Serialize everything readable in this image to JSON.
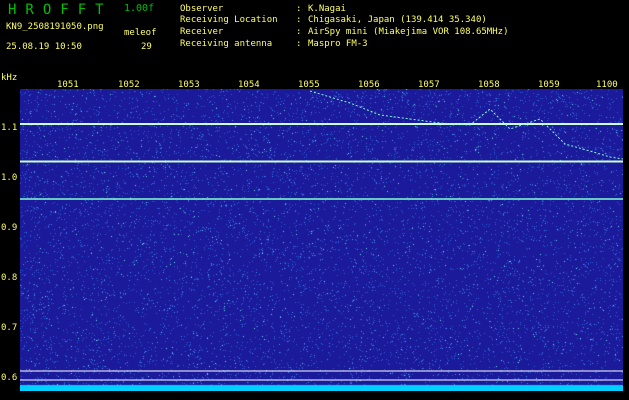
{
  "header": {
    "title": "HROFFT",
    "version": "1.00f",
    "filename": "KN9_2508191050.png",
    "datetime": "25.08.19 10:50",
    "meter_label": "meleof",
    "meter_value": "29"
  },
  "info": [
    {
      "key": "Observer",
      "value": "K.Nagai"
    },
    {
      "key": "Receiving Location",
      "value": "Chigasaki, Japan (139.414 35.340)"
    },
    {
      "key": "Receiver",
      "value": "AirSpy mini (Miakejima VOR 108.65MHz)"
    },
    {
      "key": "Receiving antenna",
      "value": "Maspro FM-3"
    }
  ],
  "colon": ":",
  "chart_data": {
    "type": "heatmap",
    "ylabel": "kHz",
    "x_ticks": [
      "1051",
      "1052",
      "1053",
      "1054",
      "1055",
      "1056",
      "1057",
      "1058",
      "1059",
      "1100"
    ],
    "y_ticks": [
      "1.1",
      "1.0",
      "0.9",
      "0.8",
      "0.7",
      "0.6"
    ],
    "y_tick_values": [
      1.1,
      1.0,
      0.9,
      0.8,
      0.7,
      0.6
    ],
    "ylim": [
      0.575,
      1.175
    ],
    "horizontal_lines_khz": [
      1.11,
      1.035,
      0.96
    ],
    "colors": {
      "background": "#1a1a9a",
      "noise": "#2f5fd8",
      "signal": "#7fffcf",
      "line": "#ffffff",
      "labels": "#ffff66",
      "baseline": "#00d0ff"
    }
  }
}
